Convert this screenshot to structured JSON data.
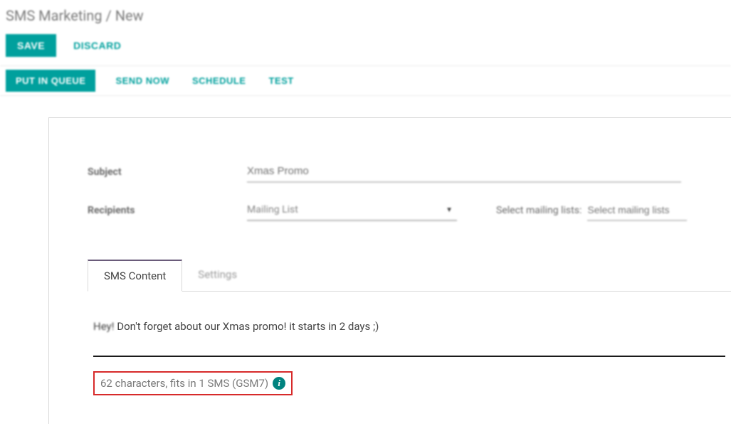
{
  "breadcrumb": "SMS Marketing / New",
  "toolbar": {
    "save_label": "SAVE",
    "discard_label": "DISCARD"
  },
  "actions": {
    "put_in_queue_label": "PUT IN QUEUE",
    "send_now_label": "SEND NOW",
    "schedule_label": "SCHEDULE",
    "test_label": "TEST"
  },
  "form": {
    "subject_label": "Subject",
    "subject_value": "Xmas Promo",
    "recipients_label": "Recipients",
    "recipients_select_value": "Mailing List",
    "mailing_lists_label": "Select mailing lists:",
    "mailing_lists_placeholder": "Select mailing lists"
  },
  "tabs": {
    "sms_content_label": "SMS Content",
    "settings_label": "Settings"
  },
  "sms": {
    "body_first": "Hey!",
    "body_rest": " Don't forget about our Xmas promo! it starts in 2 days ;)",
    "char_count_text": "62 characters, fits in 1 SMS (GSM7)"
  },
  "icons": {
    "info_glyph": "i"
  }
}
